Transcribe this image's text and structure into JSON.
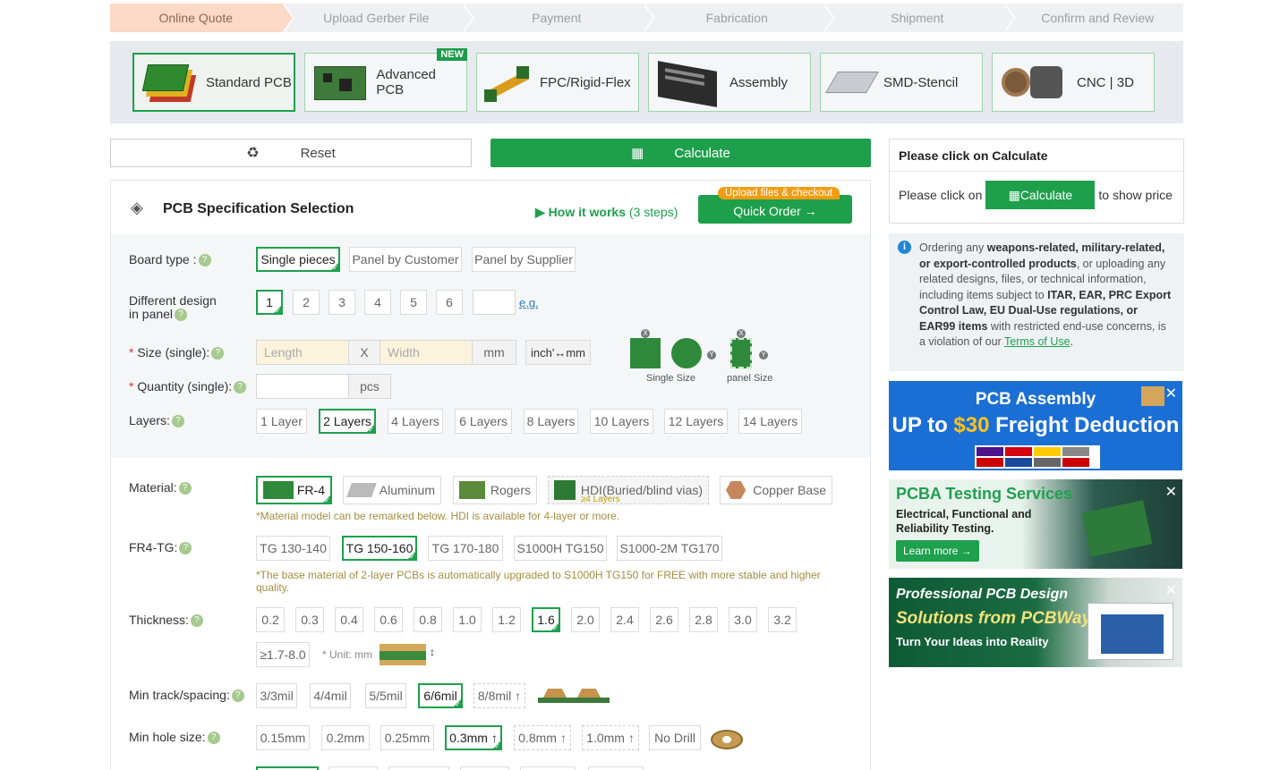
{
  "steps": [
    "Online Quote",
    "Upload Gerber File",
    "Payment",
    "Fabrication",
    "Shipment",
    "Confirm and Review"
  ],
  "products": [
    {
      "label": "Standard PCB",
      "active": true
    },
    {
      "label": "Advanced PCB",
      "badge": "NEW"
    },
    {
      "label": "FPC/Rigid-Flex"
    },
    {
      "label": "Assembly"
    },
    {
      "label": "SMD-Stencil"
    },
    {
      "label": "CNC | 3D"
    }
  ],
  "actions": {
    "reset": "Reset",
    "calculate": "Calculate"
  },
  "spec": {
    "title": "PCB Specification Selection",
    "how_it_works": "How it works",
    "how_steps": "(3 steps)",
    "quick_badge": "Upload files & checkout",
    "quick_order": "Quick Order",
    "board_type": {
      "label": "Board type :",
      "options": [
        "Single pieces",
        "Panel by Customer",
        "Panel by Supplier"
      ],
      "selected": 0
    },
    "design": {
      "label1": "Different design",
      "label2": "in panel",
      "options": [
        "1",
        "2",
        "3",
        "4",
        "5",
        "6"
      ],
      "selected": 0,
      "eg": "e.g."
    },
    "size": {
      "label": "Size (single):",
      "length_ph": "Length",
      "x": "X",
      "width_ph": "Width",
      "unit": "mm",
      "convert": "inch'↔mm",
      "single_caption": "Single Size",
      "panel_caption": "panel Size"
    },
    "quantity": {
      "label": "Quantity (single):",
      "unit": "pcs"
    },
    "layers": {
      "label": "Layers:",
      "options": [
        "1 Layer",
        "2 Layers",
        "4 Layers",
        "6 Layers",
        "8 Layers",
        "10 Layers",
        "12 Layers",
        "14 Layers"
      ],
      "selected": 1
    },
    "material": {
      "label": "Material:",
      "options": [
        "FR-4",
        "Aluminum",
        "Rogers",
        "HDI(Buried/blind vias)",
        "Copper Base"
      ],
      "hdi_sub": "≥4 Layers",
      "selected": 0,
      "note": "*Material model can be remarked below. HDI is available for 4-layer or more."
    },
    "tg": {
      "label": "FR4-TG:",
      "options": [
        "TG 130-140",
        "TG 150-160",
        "TG 170-180",
        "S1000H TG150",
        "S1000-2M TG170"
      ],
      "selected": 1,
      "note": "*The base material of 2-layer PCBs is automatically upgraded to S1000H TG150 for FREE with more stable and higher quality."
    },
    "thickness": {
      "label": "Thickness:",
      "options": [
        "0.2",
        "0.3",
        "0.4",
        "0.6",
        "0.8",
        "1.0",
        "1.2",
        "1.6",
        "2.0",
        "2.4",
        "2.6",
        "2.8",
        "3.0",
        "3.2"
      ],
      "selected": 7,
      "extra": "≥1.7-8.0",
      "unit_note": "* Unit: mm"
    },
    "track": {
      "label": "Min track/spacing:",
      "options": [
        "3/3mil",
        "4/4mil",
        "5/5mil",
        "6/6mil",
        "8/8mil ↑"
      ],
      "selected": 3
    },
    "hole": {
      "label": "Min hole size:",
      "options": [
        "0.15mm",
        "0.2mm",
        "0.25mm",
        "0.3mm ↑",
        "0.8mm ↑",
        "1.0mm ↑",
        "No Drill"
      ],
      "selected": 3
    }
  },
  "right": {
    "header": "Please click on Calculate",
    "pre": "Please click on",
    "btn": "Calculate",
    "post": "to show price",
    "warning": {
      "t1": "Ordering any ",
      "b1": "weapons-related, military-related, or export-controlled products",
      "t2": ", or uploading any related designs, files, or technical information, including items subject to ",
      "b2": "ITAR, EAR, PRC Export Control Law, EU Dual-Use regulations, or EAR99 items",
      "t3": " with restricted end-use concerns, is a violation of our ",
      "link": "Terms of Use",
      "t4": "."
    }
  },
  "ads": [
    {
      "l1": "PCB Assembly",
      "l2a": "UP to ",
      "l2b": "$30",
      "l2c": " Freight Deduction"
    },
    {
      "l1": "PCBA Testing Services",
      "l2": "Electrical, Functional and",
      "l3": "Reliability Testing.",
      "btn": "Learn more →"
    },
    {
      "l1": "Professional PCB Design",
      "l2": "Solutions from PCBWay",
      "l3": "Turn Your Ideas into Reality"
    }
  ],
  "colors": {
    "accent": "#1e9f4b",
    "step_active": "#fbd9c6"
  }
}
